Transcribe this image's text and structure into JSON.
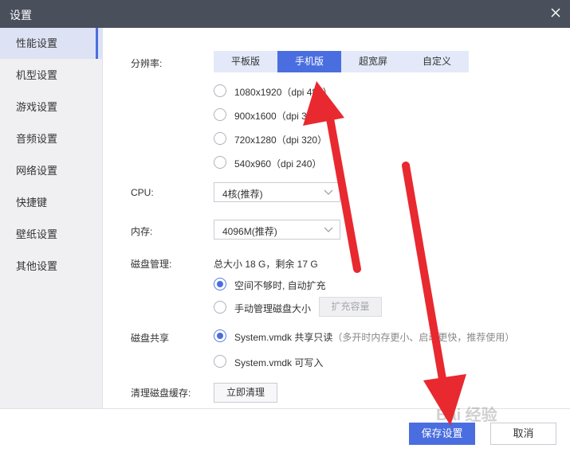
{
  "window": {
    "title": "设置",
    "close_icon": "close-icon"
  },
  "sidebar": {
    "items": [
      {
        "label": "性能设置",
        "active": true
      },
      {
        "label": "机型设置"
      },
      {
        "label": "游戏设置"
      },
      {
        "label": "音频设置"
      },
      {
        "label": "网络设置"
      },
      {
        "label": "快捷键"
      },
      {
        "label": "壁纸设置"
      },
      {
        "label": "其他设置"
      }
    ]
  },
  "resolution": {
    "label": "分辨率:",
    "tabs": [
      {
        "label": "平板版"
      },
      {
        "label": "手机版",
        "active": true
      },
      {
        "label": "超宽屏"
      },
      {
        "label": "自定义"
      }
    ],
    "options": [
      {
        "label": "1080x1920（dpi 480）"
      },
      {
        "label": "900x1600（dpi 320）"
      },
      {
        "label": "720x1280（dpi 320）"
      },
      {
        "label": "540x960（dpi 240）"
      }
    ]
  },
  "cpu": {
    "label": "CPU:",
    "value": "4核(推荐)"
  },
  "memory": {
    "label": "内存:",
    "value": "4096M(推荐)"
  },
  "disk": {
    "label": "磁盘管理:",
    "info": "总大小 18 G，剩余 17 G",
    "options": [
      {
        "label": "空间不够时, 自动扩充",
        "checked": true
      },
      {
        "label": "手动管理磁盘大小"
      }
    ],
    "expand_label": "扩充容量"
  },
  "share": {
    "label": "磁盘共享",
    "options": [
      {
        "label": "System.vmdk 共享只读",
        "hint": "（多开时内存更小、启动更快，推荐使用）",
        "checked": true
      },
      {
        "label": "System.vmdk 可写入"
      }
    ]
  },
  "cache": {
    "label": "清理磁盘缓存:",
    "button_label": "立即清理"
  },
  "footer": {
    "save_label": "保存设置",
    "cancel_label": "取消"
  },
  "watermark": {
    "text": "Bai 经验"
  },
  "colors": {
    "accent": "#4a6ee0",
    "titlebar": "#4a4f5c",
    "arrow": "#e8292f"
  }
}
